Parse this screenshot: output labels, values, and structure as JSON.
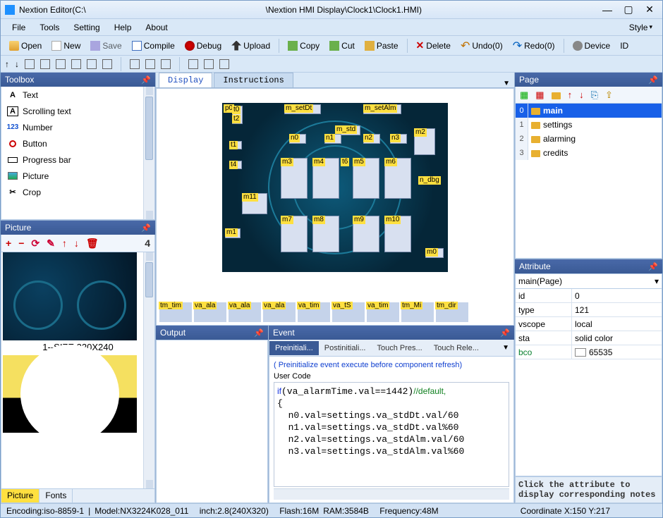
{
  "title": {
    "app_prefix": "Nextion Editor(C:\\",
    "path": "\\Nextion HMI Display\\Clock1\\Clock1.HMI)"
  },
  "menu": {
    "file": "File",
    "tools": "Tools",
    "setting": "Setting",
    "help": "Help",
    "about": "About",
    "style": "Style"
  },
  "toolbar": {
    "open": "Open",
    "new": "New",
    "save": "Save",
    "compile": "Compile",
    "debug": "Debug",
    "upload": "Upload",
    "copy": "Copy",
    "cut": "Cut",
    "paste": "Paste",
    "delete": "Delete",
    "undo": "Undo(0)",
    "redo": "Redo(0)",
    "device": "Device",
    "id": "ID"
  },
  "panels": {
    "toolbox": "Toolbox",
    "picture": "Picture",
    "output": "Output",
    "event": "Event",
    "page": "Page",
    "attribute": "Attribute"
  },
  "toolbox_items": [
    {
      "icon": "A",
      "label": "Text"
    },
    {
      "icon": "A",
      "label": "Scrolling text",
      "boxed": true
    },
    {
      "icon": "123",
      "label": "Number",
      "num": true
    },
    {
      "icon": "○",
      "label": "Button"
    },
    {
      "icon": "▭",
      "label": "Progress bar"
    },
    {
      "icon": "▣",
      "label": "Picture"
    },
    {
      "icon": "✂",
      "label": "Crop"
    }
  ],
  "picture": {
    "count": "4",
    "thumb_label": "1--SIZE:320X240",
    "tabs": [
      "Picture",
      "Fonts"
    ]
  },
  "display": {
    "tabs": [
      "Display",
      "Instructions"
    ],
    "components": {
      "p0": "p0",
      "t0": "t0",
      "t2": "t2",
      "m_setDt": "m_setDt",
      "m_setAlm": "m_setAlm",
      "m_std": "m_std",
      "t1": "t1",
      "t4": "t4",
      "n0": "n0",
      "n1": "n1",
      "n2": "n2",
      "n3": "n3",
      "m2": "m2",
      "m3": "m3",
      "m4": "m4",
      "t6": "t6",
      "m5": "m5",
      "m6": "m6",
      "n_dbg": "n_dbg",
      "m11": "m11",
      "m7": "m7",
      "m8": "m8",
      "m9": "m9",
      "m10": "m10",
      "m1": "m1",
      "m0": "m0"
    },
    "timers": [
      "tm_tim",
      "va_ala",
      "va_ala",
      "va_ala",
      "va_tim",
      "va_tS",
      "va_tim",
      "tm_Mi",
      "tm_dir"
    ]
  },
  "pages": [
    {
      "idx": "0",
      "name": "main",
      "sel": true
    },
    {
      "idx": "1",
      "name": "settings"
    },
    {
      "idx": "2",
      "name": "alarming"
    },
    {
      "idx": "3",
      "name": "credits"
    }
  ],
  "attribute": {
    "target": "main(Page)",
    "rows": [
      {
        "k": "id",
        "v": "0"
      },
      {
        "k": "type",
        "v": "121"
      },
      {
        "k": "vscope",
        "v": "local"
      },
      {
        "k": "sta",
        "v": "solid color"
      },
      {
        "k": "bco",
        "v": "65535",
        "swatch": true
      }
    ],
    "note": "Click the attribute to display corresponding notes"
  },
  "event": {
    "tabs": [
      "Preinitiali...",
      "Postinitiali...",
      "Touch Pres...",
      "Touch Rele..."
    ],
    "note": "( Preinitialize event execute before component refresh)",
    "user_code_label": "User Code",
    "code": "if(va_alarmTime.val==1442)//default,\n{\n  n0.val=settings.va_stdDt.val/60\n  n1.val=settings.va_stdDt.val%60\n  n2.val=settings.va_stdAlm.val/60\n  n3.val=settings.va_stdAlm.val%60"
  },
  "status": {
    "encoding": "Encoding:iso-8859-1",
    "model": "Model:NX3224K028_011",
    "inch": "inch:2.8(240X320)",
    "flash": "Flash:16M",
    "ram": "RAM:3584B",
    "freq": "Frequency:48M",
    "coord": "Coordinate X:150  Y:217"
  }
}
